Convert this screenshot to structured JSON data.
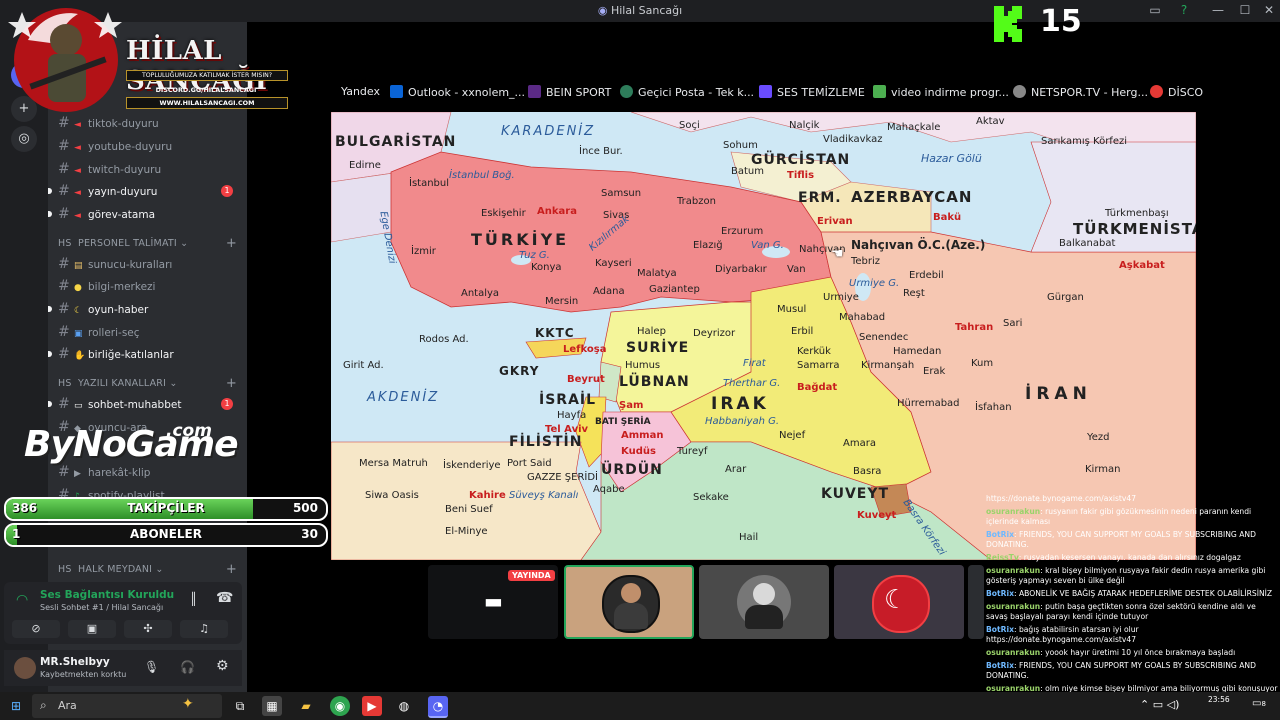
{
  "window": {
    "title": "Hilal Sancağı",
    "close": "✕",
    "max": "☐",
    "min": "—"
  },
  "logo": {
    "title": "HİLAL SANCAĞI",
    "subtitle": "TOPLULUĞUMUZA KATILMAK İSTER MISIN?",
    "discord": "DISCORD.GG/HILALSANCAGI",
    "website": "WWW.HILALSANCAGI.COM"
  },
  "channels": [
    {
      "name": "tiktok-duyuru",
      "icon": "📢"
    },
    {
      "name": "youtube-duyuru",
      "icon": "📢"
    },
    {
      "name": "twitch-duyuru",
      "icon": "📢"
    },
    {
      "name": "yayın-duyuru",
      "icon": "📢",
      "unread": true,
      "badge": "1"
    },
    {
      "name": "görev-atama",
      "icon": "📢",
      "unread": true
    },
    {
      "name": "sunucu-kuralları",
      "icon": "📜"
    },
    {
      "name": "bilgi-merkezi",
      "icon": "💡"
    },
    {
      "name": "oyun-haber",
      "icon": "🌙",
      "unread": true
    },
    {
      "name": "rolleri-seç",
      "icon": "🔢"
    },
    {
      "name": "birliğe-katılanlar",
      "icon": "👋",
      "unread": true
    },
    {
      "name": "sohbet-muhabbet",
      "icon": "💬",
      "unread": true,
      "badge": "1"
    },
    {
      "name": "oyuncu-ara",
      "icon": "🎮"
    },
    {
      "name": "harekât-klip",
      "icon": "🎬"
    },
    {
      "name": "spotify-playlist",
      "icon": "🎵"
    }
  ],
  "categories": {
    "personel": "PERSONEL TALİMATI",
    "yazili": "YAZILI KANALLARI",
    "halk": "HALK MEYDANI",
    "prefix": "HS"
  },
  "bynogame": {
    "main": "ByNoGame",
    "suffix": ".com"
  },
  "followers": {
    "current": "386",
    "label": "TAKİPÇİLER",
    "goal": "500",
    "progress": 0.772
  },
  "subscribers": {
    "current": "1",
    "label": "ABONELER",
    "goal": "30",
    "progress": 0.033
  },
  "voice": {
    "status": "Ses Bağlantısı Kuruldu",
    "channel": "Sesli Sohbet #1 / Hilal Sancağı"
  },
  "user": {
    "name": "MR.Shelbyy",
    "status": "Kaybetmekten korktu"
  },
  "bookmarks": [
    {
      "label": "Yandex",
      "color": "#ff3333"
    },
    {
      "label": "Outlook - xxnolem_...",
      "color": "#0a64d6"
    },
    {
      "label": "BEIN SPORT",
      "color": "#5b2a86"
    },
    {
      "label": "Geçici Posta - Tek k...",
      "color": "#2e7d5b"
    },
    {
      "label": "SES TEMİZLEME",
      "color": "#6a4cff"
    },
    {
      "label": "video indirme progr...",
      "color": "#4caf50"
    },
    {
      "label": "NETSPOR.TV - Herg...",
      "color": "#888888"
    },
    {
      "label": "DİSCO",
      "color": "#e53935"
    }
  ],
  "map": {
    "countries": [
      "BULGARİSTAN",
      "TÜRKİYE",
      "GÜRCİSTAN",
      "ERM.",
      "AZERBAYCAN",
      "TÜRKMENİSTAN",
      "SURİYE",
      "LÜBNAN",
      "İSRAİL",
      "FİLİSTİN",
      "ÜRDÜN",
      "IRAK",
      "İRAN",
      "KUVEYT",
      "KKTC",
      "GKRY",
      "BATI ŞERİA",
      "GAZZE ŞERİDİ",
      "Nahçıvan Ö.C.(Aze.)"
    ],
    "seas": [
      "KARADENİZ",
      "AKDENİZ",
      "Hazar Gölü",
      "Ege Denizi",
      "Basra Körfezi"
    ],
    "capitals": [
      "Ankara",
      "Tiflis",
      "Erivan",
      "Bakü",
      "Lefkoşa",
      "Beyrut",
      "Şam",
      "Tel Aviv",
      "Kudüs",
      "Amman",
      "Bağdat",
      "Tahran",
      "Aşkabat",
      "Kahire",
      "Kuveyt"
    ],
    "cities": [
      "Soçi",
      "Mahaçkale",
      "Aktav",
      "Sarıkamış Körfezi",
      "İnce Bur.",
      "Vladikavkaz",
      "Nalçik",
      "Sohum",
      "Batum",
      "İstanbul Boğ.",
      "İstanbul",
      "Edirne",
      "Samsun",
      "Trabzon",
      "Sivas",
      "Eskişehir",
      "Erzurum",
      "İzmir",
      "Konya",
      "Kayseri",
      "Elazığ",
      "Van G.",
      "Tuz G.",
      "Malatya",
      "Diyarbakır",
      "Van",
      "Nahçıvan",
      "Tebriz",
      "Erdebil",
      "Reşt",
      "Türkmenbaşı",
      "Balkanabat",
      "Gürgan",
      "Antalya",
      "Mersin",
      "Adana",
      "Gaziantep",
      "Urmiye",
      "Urmiye G.",
      "Mahabad",
      "Musul",
      "Erbil",
      "Kerkük",
      "Sari",
      "Rodos Ad.",
      "Halep",
      "Deyrizor",
      "Humus",
      "Senendec",
      "Hamedan",
      "Kum",
      "Girit Ad.",
      "Firat",
      "Samarra",
      "Kirmanşah",
      "Erak",
      "Hayfa",
      "Therthar G.",
      "Habbaniyah G.",
      "Hürremabad",
      "İsfahan",
      "Nejef",
      "Yezd",
      "Mersa Matruh",
      "İskenderiye",
      "Port Said",
      "Tureyf",
      "Amara",
      "Basra",
      "Siwa Oasis",
      "Süveyş Kanalı",
      "Aqabe",
      "Arar",
      "Kirman",
      "Beni Suef",
      "El-Minye",
      "Sekake",
      "Hail",
      "Kızılırmak"
    ]
  },
  "kick": {
    "count": "15"
  },
  "stream": {
    "live_label": "YAYINDA"
  },
  "chat": [
    {
      "user": "",
      "text": "https://donate.bynogame.com/axistv47",
      "kind": "plain"
    },
    {
      "user": "osuranrakun",
      "text": ": rusyanın fakir gibi gözükmesinin nedeni paranın kendi içlerinde kalması",
      "kind": "user"
    },
    {
      "user": "BotRix",
      "text": ": FRIENDS, YOU CAN SUPPORT MY GOALS BY SUBSCRIBING AND DONATING.",
      "kind": "bot"
    },
    {
      "user": "ReissTv",
      "text": ": rusyadan kesersen vanayı. kanada dan alırsınız dogalgaz",
      "kind": "user"
    },
    {
      "user": "osuranrakun",
      "text": ": kral bişey bilmiyon rusyaya fakir dedin rusya amerika gibi gösteriş yapmayı seven bi ülke değil",
      "kind": "user"
    },
    {
      "user": "BotRix",
      "text": ": ABONELİK VE BAĞIŞ ATARAK HEDEFLERİME DESTEK OLABİLİRSİNİZ",
      "kind": "bot"
    },
    {
      "user": "osuranrakun",
      "text": ": putin başa geçtikten sonra özel sektörü kendine aldı ve savaş başlayalı parayı kendi içinde tutuyor",
      "kind": "user"
    },
    {
      "user": "BotRix",
      "text": ": bağış atabilirsin atarsan iyi olur https://donate.bynogame.com/axistv47",
      "kind": "bot"
    },
    {
      "user": "osuranrakun",
      "text": ": yoook hayır üretimi 10 yıl önce bırakmaya başladı",
      "kind": "user"
    },
    {
      "user": "BotRix",
      "text": ": FRIENDS, YOU CAN SUPPORT MY GOALS BY SUBSCRIBING AND DONATING.",
      "kind": "bot"
    },
    {
      "user": "osuranrakun",
      "text": ": olm niye kimse bişey bilmiyor ama biliyormuş gibi konuşuyor",
      "kind": "user"
    }
  ],
  "taskbar": {
    "search": "Ara",
    "time": "23:56",
    "date": "",
    "notif": "8"
  }
}
